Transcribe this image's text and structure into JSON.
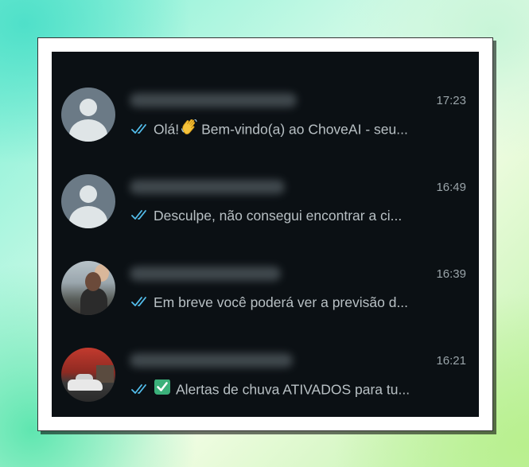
{
  "colors": {
    "background": "#0b1014",
    "read_tick": "#53bdeb",
    "time_text": "#9aa4a9",
    "preview_text": "#b8c0c4",
    "check_badge": "#3bb07a"
  },
  "chats": [
    {
      "avatar": "default-user-icon",
      "time": "17:23",
      "status": "read",
      "emoji": "waving-hand-icon",
      "preview_before": "Olá!",
      "preview_after": "Bem-vindo(a) ao ChoveAI - seu..."
    },
    {
      "avatar": "default-user-icon",
      "time": "16:49",
      "status": "read",
      "preview": "Desculpe, não consegui encontrar a ci..."
    },
    {
      "avatar": "profile-photo-couple",
      "time": "16:39",
      "status": "read",
      "preview": "Em breve você poderá ver a previsão d..."
    },
    {
      "avatar": "profile-photo-car",
      "time": "16:21",
      "status": "read",
      "emoji": "check-mark-button-icon",
      "preview": "Alertas de chuva ATIVADOS para tu..."
    }
  ]
}
